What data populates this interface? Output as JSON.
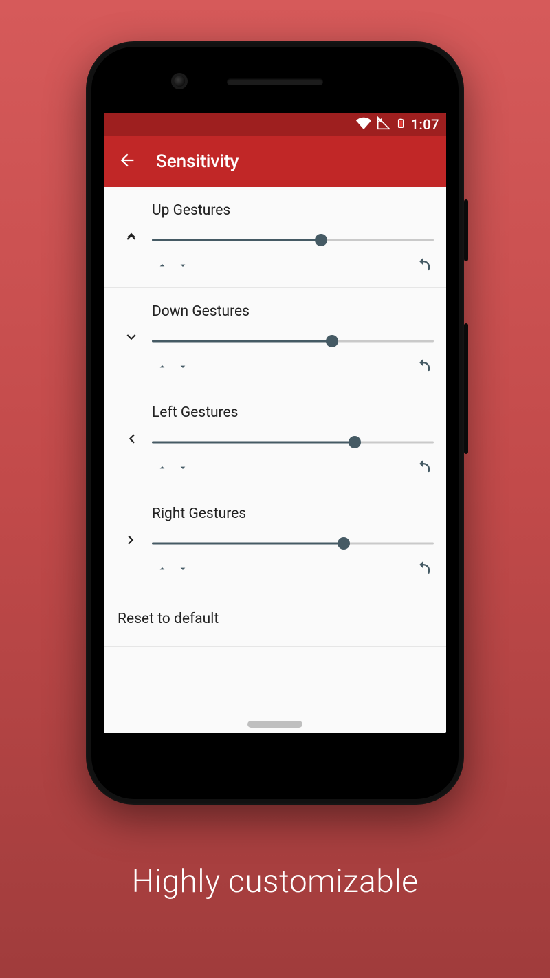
{
  "caption": "Highly customizable",
  "statusbar": {
    "time": "1:07"
  },
  "appbar": {
    "title": "Sensitivity"
  },
  "gestures": [
    {
      "label": "Up Gestures",
      "direction": "up",
      "value_pct": 60
    },
    {
      "label": "Down Gestures",
      "direction": "down",
      "value_pct": 64
    },
    {
      "label": "Left Gestures",
      "direction": "left",
      "value_pct": 72
    },
    {
      "label": "Right Gestures",
      "direction": "right",
      "value_pct": 68
    }
  ],
  "reset_label": "Reset to default",
  "colors": {
    "primary": "#c12727",
    "primary_dark": "#9e1f1f",
    "slider": "#455a64"
  }
}
